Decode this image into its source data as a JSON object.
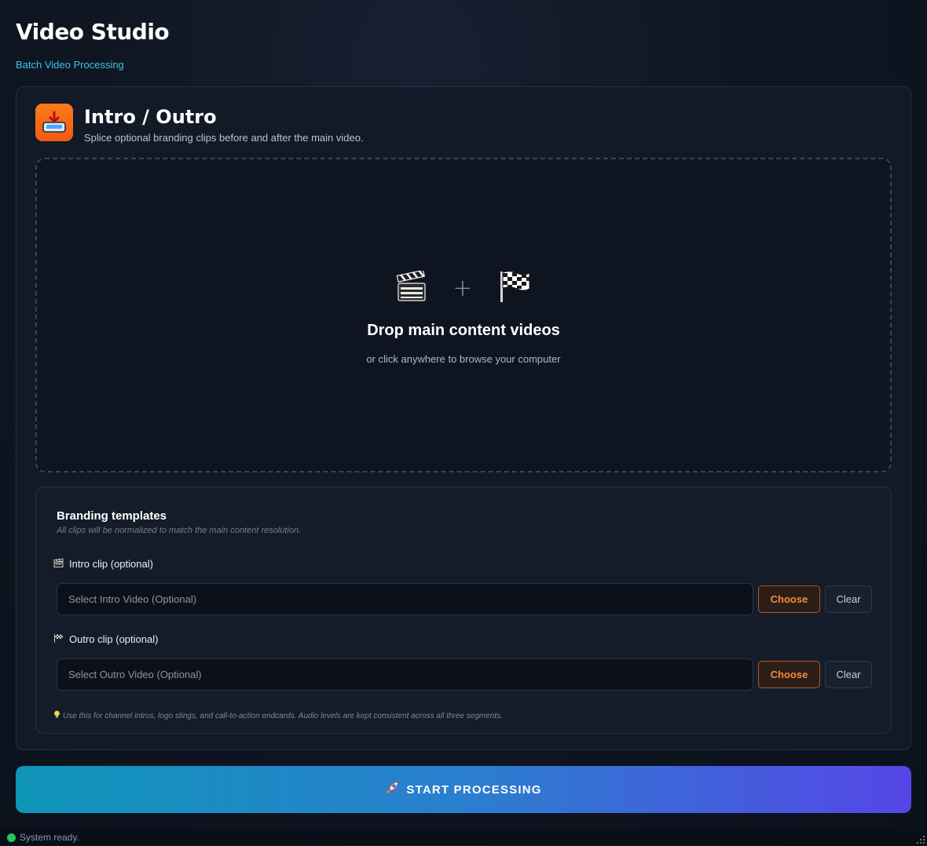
{
  "app": {
    "title": "Video Studio",
    "subtitle": "Batch Video Processing"
  },
  "module": {
    "icon": "download-tray-icon",
    "title": "Intro / Outro",
    "description": "Splice optional branding clips before and after the main video."
  },
  "dropzone": {
    "icons": [
      "clapperboard-icon",
      "plus-icon",
      "checkered-flag-icon"
    ],
    "plus_symbol": "+",
    "title": "Drop main content videos",
    "subtitle": "or click anywhere to browse your computer"
  },
  "branding": {
    "title": "Branding templates",
    "note": "All clips will be normalized to match the main content resolution.",
    "intro": {
      "label": "Intro clip (optional)",
      "icon": "clapperboard-icon",
      "placeholder": "Select Intro Video (Optional)",
      "value": "",
      "choose_label": "Choose",
      "clear_label": "Clear"
    },
    "outro": {
      "label": "Outro clip (optional)",
      "icon": "checkered-flag-icon",
      "placeholder": "Select Outro Video (Optional)",
      "value": "",
      "choose_label": "Choose",
      "clear_label": "Clear"
    },
    "tip": "Use this for channel intros, logo stings, and call-to-action endcards. Audio levels are kept consistent across all three segments.",
    "tip_icon": "lightbulb-icon"
  },
  "start_button": {
    "icon": "rocket-icon",
    "label": "START PROCESSING"
  },
  "status": {
    "text": "System ready.",
    "state_color": "#22c55e"
  },
  "colors": {
    "accent_orange": "#f15a0f",
    "accent_cyan": "#38c6e8",
    "button_gradient_start": "#0e95b8",
    "button_gradient_end": "#5546e6"
  }
}
